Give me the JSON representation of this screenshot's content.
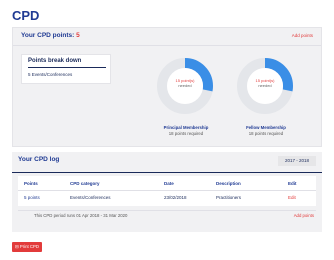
{
  "page": {
    "title": "CPD"
  },
  "points": {
    "label": "Your CPD points:",
    "value": "5",
    "add_points": "Add points"
  },
  "breakdown": {
    "title": "Points break down",
    "item": "5 Events/Conferences"
  },
  "memberships": [
    {
      "points_text": "15 point(s)",
      "needed_text": "needed",
      "name": "Principal Membership",
      "required": "18 points required",
      "fraction": 0.28
    },
    {
      "points_text": "15 point(s)",
      "needed_text": "needed",
      "name": "Fellow Membership",
      "required": "18 points required",
      "fraction": 0.28
    }
  ],
  "log": {
    "title": "Your CPD log",
    "year": "2017 - 2018",
    "headers": {
      "points": "Points",
      "category": "CPD category",
      "date": "Date",
      "description": "Description",
      "edit": "Edit"
    },
    "rows": [
      {
        "points": "5 points",
        "category": "Events/Conferences",
        "date": "23/02/2018",
        "description": "Practitioners",
        "edit": "Edit"
      }
    ],
    "period": "This CPD period runs 01 Apr 2018 - 31 Mar 2020",
    "add_points": "Add points"
  },
  "print_button": "⊟ Print CPD",
  "colors": {
    "accent": "#1f3a93",
    "danger": "#e23b3b",
    "chart": "#3a8ee6",
    "chart_track": "#e4e6ea"
  }
}
